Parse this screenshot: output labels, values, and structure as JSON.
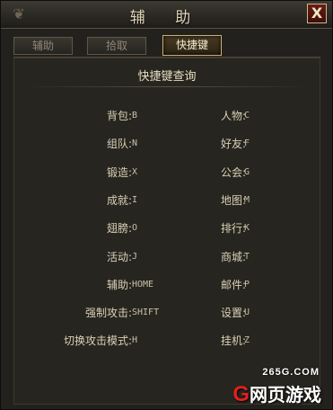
{
  "window": {
    "title": "辅 助",
    "close_label": "X"
  },
  "tabs": [
    {
      "label": "辅助",
      "active": false
    },
    {
      "label": "拾取",
      "active": false
    },
    {
      "label": "快捷键",
      "active": true
    }
  ],
  "section_title": "快捷键查询",
  "shortcuts": [
    [
      {
        "label": "背包:",
        "key": "B"
      },
      {
        "label": "人物:",
        "key": "C"
      }
    ],
    [
      {
        "label": "组队:",
        "key": "N"
      },
      {
        "label": "好友:",
        "key": "F"
      }
    ],
    [
      {
        "label": "锻造:",
        "key": "X"
      },
      {
        "label": "公会:",
        "key": "G"
      }
    ],
    [
      {
        "label": "成就:",
        "key": "I"
      },
      {
        "label": "地图:",
        "key": "M"
      }
    ],
    [
      {
        "label": "翅膀:",
        "key": "O"
      },
      {
        "label": "排行:",
        "key": "K"
      }
    ],
    [
      {
        "label": "活动:",
        "key": "J"
      },
      {
        "label": "商城:",
        "key": "T"
      }
    ],
    [
      {
        "label": "辅助:",
        "key": "HOME"
      },
      {
        "label": "邮件:",
        "key": "P"
      }
    ],
    [
      {
        "label": "强制攻击:",
        "key": "SHIFT"
      },
      {
        "label": "设置:",
        "key": "U"
      }
    ],
    [
      {
        "label": "切换攻击模式:",
        "key": "H"
      },
      {
        "label": "挂机:",
        "key": "Z"
      }
    ]
  ],
  "watermark": {
    "domain": "265G.COM",
    "logo_g": "G",
    "logo_text": "网页游戏"
  },
  "colors": {
    "accent": "#c9b170",
    "close_bg": "#6a1d12"
  }
}
